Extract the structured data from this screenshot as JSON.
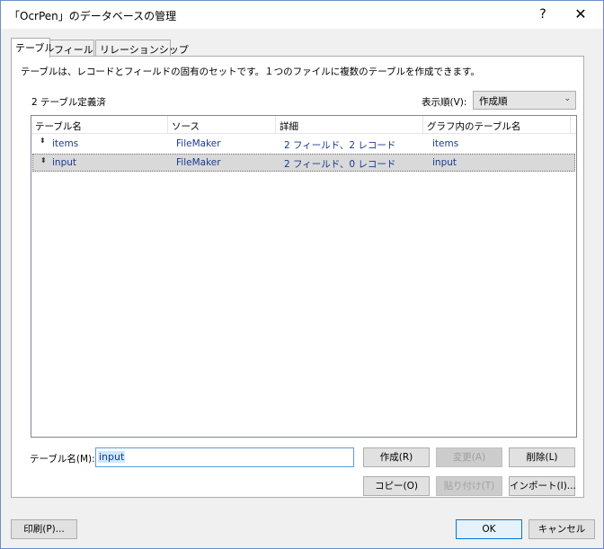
{
  "window": {
    "title": "「OcrPen」のデータベースの管理",
    "help": "?",
    "close": "✕"
  },
  "tabs": [
    {
      "label": "テーブル",
      "active": true
    },
    {
      "label": "フィールド",
      "active": false
    },
    {
      "label": "リレーションシップ",
      "active": false
    }
  ],
  "panel": {
    "description": "テーブルは、レコードとフィールドの固有のセットです。１つのファイルに複数のテーブルを作成できます。",
    "count": "2 テーブル定義済",
    "sort_label": "表示順(V):",
    "sort_value": "作成順",
    "sort_arrow": "⌄"
  },
  "table": {
    "headers": [
      "テーブル名",
      "ソース",
      "詳細",
      "グラフ内のテーブル名"
    ],
    "rows": [
      {
        "name": "items",
        "source": "FileMaker",
        "detail": "2 フィールド、2 レコード",
        "graph_name": "items",
        "selected": false
      },
      {
        "name": "input",
        "source": "FileMaker",
        "detail": "2 フィールド、0 レコード",
        "graph_name": "input",
        "selected": true
      }
    ],
    "grip": "⬍"
  },
  "name_field": {
    "label": "テーブル名(M):",
    "value": "input"
  },
  "buttons": {
    "create": "作成(R)",
    "change": "変更(A)",
    "delete": "削除(L)",
    "copy": "コピー(O)",
    "paste": "貼り付け(T)",
    "import": "インポート(I)...",
    "print": "印刷(P)...",
    "ok": "OK",
    "cancel": "キャンセル"
  },
  "colors": {
    "accent": "#0078d7",
    "link_text": "#1a3a8f",
    "selection_bg": "#d9d9d9"
  }
}
